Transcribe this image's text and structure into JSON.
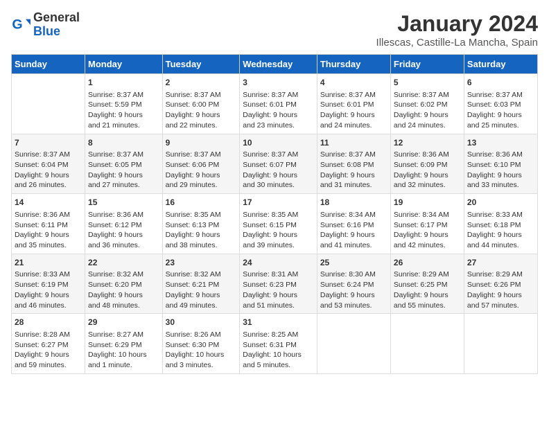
{
  "header": {
    "logo_general": "General",
    "logo_blue": "Blue",
    "title": "January 2024",
    "subtitle": "Illescas, Castille-La Mancha, Spain"
  },
  "days_of_week": [
    "Sunday",
    "Monday",
    "Tuesday",
    "Wednesday",
    "Thursday",
    "Friday",
    "Saturday"
  ],
  "weeks": [
    [
      {
        "day": "",
        "info": ""
      },
      {
        "day": "1",
        "info": "Sunrise: 8:37 AM\nSunset: 5:59 PM\nDaylight: 9 hours\nand 21 minutes."
      },
      {
        "day": "2",
        "info": "Sunrise: 8:37 AM\nSunset: 6:00 PM\nDaylight: 9 hours\nand 22 minutes."
      },
      {
        "day": "3",
        "info": "Sunrise: 8:37 AM\nSunset: 6:01 PM\nDaylight: 9 hours\nand 23 minutes."
      },
      {
        "day": "4",
        "info": "Sunrise: 8:37 AM\nSunset: 6:01 PM\nDaylight: 9 hours\nand 24 minutes."
      },
      {
        "day": "5",
        "info": "Sunrise: 8:37 AM\nSunset: 6:02 PM\nDaylight: 9 hours\nand 24 minutes."
      },
      {
        "day": "6",
        "info": "Sunrise: 8:37 AM\nSunset: 6:03 PM\nDaylight: 9 hours\nand 25 minutes."
      }
    ],
    [
      {
        "day": "7",
        "info": "Sunrise: 8:37 AM\nSunset: 6:04 PM\nDaylight: 9 hours\nand 26 minutes."
      },
      {
        "day": "8",
        "info": "Sunrise: 8:37 AM\nSunset: 6:05 PM\nDaylight: 9 hours\nand 27 minutes."
      },
      {
        "day": "9",
        "info": "Sunrise: 8:37 AM\nSunset: 6:06 PM\nDaylight: 9 hours\nand 29 minutes."
      },
      {
        "day": "10",
        "info": "Sunrise: 8:37 AM\nSunset: 6:07 PM\nDaylight: 9 hours\nand 30 minutes."
      },
      {
        "day": "11",
        "info": "Sunrise: 8:37 AM\nSunset: 6:08 PM\nDaylight: 9 hours\nand 31 minutes."
      },
      {
        "day": "12",
        "info": "Sunrise: 8:36 AM\nSunset: 6:09 PM\nDaylight: 9 hours\nand 32 minutes."
      },
      {
        "day": "13",
        "info": "Sunrise: 8:36 AM\nSunset: 6:10 PM\nDaylight: 9 hours\nand 33 minutes."
      }
    ],
    [
      {
        "day": "14",
        "info": "Sunrise: 8:36 AM\nSunset: 6:11 PM\nDaylight: 9 hours\nand 35 minutes."
      },
      {
        "day": "15",
        "info": "Sunrise: 8:36 AM\nSunset: 6:12 PM\nDaylight: 9 hours\nand 36 minutes."
      },
      {
        "day": "16",
        "info": "Sunrise: 8:35 AM\nSunset: 6:13 PM\nDaylight: 9 hours\nand 38 minutes."
      },
      {
        "day": "17",
        "info": "Sunrise: 8:35 AM\nSunset: 6:15 PM\nDaylight: 9 hours\nand 39 minutes."
      },
      {
        "day": "18",
        "info": "Sunrise: 8:34 AM\nSunset: 6:16 PM\nDaylight: 9 hours\nand 41 minutes."
      },
      {
        "day": "19",
        "info": "Sunrise: 8:34 AM\nSunset: 6:17 PM\nDaylight: 9 hours\nand 42 minutes."
      },
      {
        "day": "20",
        "info": "Sunrise: 8:33 AM\nSunset: 6:18 PM\nDaylight: 9 hours\nand 44 minutes."
      }
    ],
    [
      {
        "day": "21",
        "info": "Sunrise: 8:33 AM\nSunset: 6:19 PM\nDaylight: 9 hours\nand 46 minutes."
      },
      {
        "day": "22",
        "info": "Sunrise: 8:32 AM\nSunset: 6:20 PM\nDaylight: 9 hours\nand 48 minutes."
      },
      {
        "day": "23",
        "info": "Sunrise: 8:32 AM\nSunset: 6:21 PM\nDaylight: 9 hours\nand 49 minutes."
      },
      {
        "day": "24",
        "info": "Sunrise: 8:31 AM\nSunset: 6:23 PM\nDaylight: 9 hours\nand 51 minutes."
      },
      {
        "day": "25",
        "info": "Sunrise: 8:30 AM\nSunset: 6:24 PM\nDaylight: 9 hours\nand 53 minutes."
      },
      {
        "day": "26",
        "info": "Sunrise: 8:29 AM\nSunset: 6:25 PM\nDaylight: 9 hours\nand 55 minutes."
      },
      {
        "day": "27",
        "info": "Sunrise: 8:29 AM\nSunset: 6:26 PM\nDaylight: 9 hours\nand 57 minutes."
      }
    ],
    [
      {
        "day": "28",
        "info": "Sunrise: 8:28 AM\nSunset: 6:27 PM\nDaylight: 9 hours\nand 59 minutes."
      },
      {
        "day": "29",
        "info": "Sunrise: 8:27 AM\nSunset: 6:29 PM\nDaylight: 10 hours\nand 1 minute."
      },
      {
        "day": "30",
        "info": "Sunrise: 8:26 AM\nSunset: 6:30 PM\nDaylight: 10 hours\nand 3 minutes."
      },
      {
        "day": "31",
        "info": "Sunrise: 8:25 AM\nSunset: 6:31 PM\nDaylight: 10 hours\nand 5 minutes."
      },
      {
        "day": "",
        "info": ""
      },
      {
        "day": "",
        "info": ""
      },
      {
        "day": "",
        "info": ""
      }
    ]
  ]
}
